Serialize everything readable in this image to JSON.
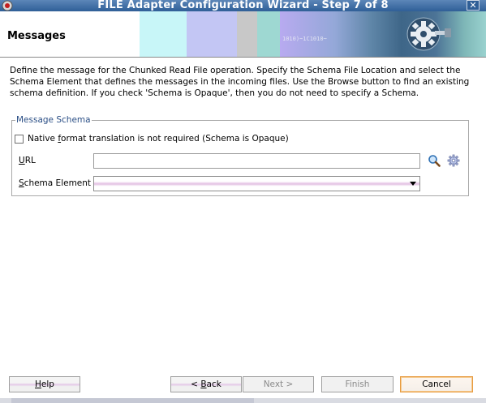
{
  "window": {
    "title": "FILE Adapter Configuration Wizard - Step 7 of 8",
    "close_glyph": "✕"
  },
  "header": {
    "title": "Messages",
    "banner_text": "1010)~1C1010~"
  },
  "description": "Define the message for the Chunked Read File operation.  Specify the Schema File Location and select the Schema Element that defines the messages in the incoming files. Use the Browse button to find an existing schema definition. If you check 'Schema is Opaque', then you do not need to specify a Schema.",
  "message_schema": {
    "legend": "Message Schema",
    "opaque_checkbox": {
      "label_pre": "Native ",
      "label_mnemonic": "f",
      "label_post": "ormat translation is not required (Schema is Opaque)",
      "checked": false
    },
    "url": {
      "label_mnemonic": "U",
      "label_post": "RL",
      "value": ""
    },
    "schema_element": {
      "label_mnemonic": "S",
      "label_post": "chema Element",
      "value": ""
    }
  },
  "buttons": {
    "help": {
      "mnemonic": "H",
      "rest": "elp"
    },
    "back": {
      "pre": "< ",
      "mnemonic": "B",
      "rest": "ack"
    },
    "next": "Next >",
    "finish": "Finish",
    "cancel": "Cancel"
  },
  "colors": {
    "titlebar": "#2f5f97",
    "legend": "#2b4f86",
    "cancel_focus": "#e79a3f"
  },
  "icons": {
    "app": "oracle-app-icon",
    "browse": "search-icon",
    "schema_browser": "gear-icon",
    "banner_graphic": "gear-plug-icon"
  }
}
